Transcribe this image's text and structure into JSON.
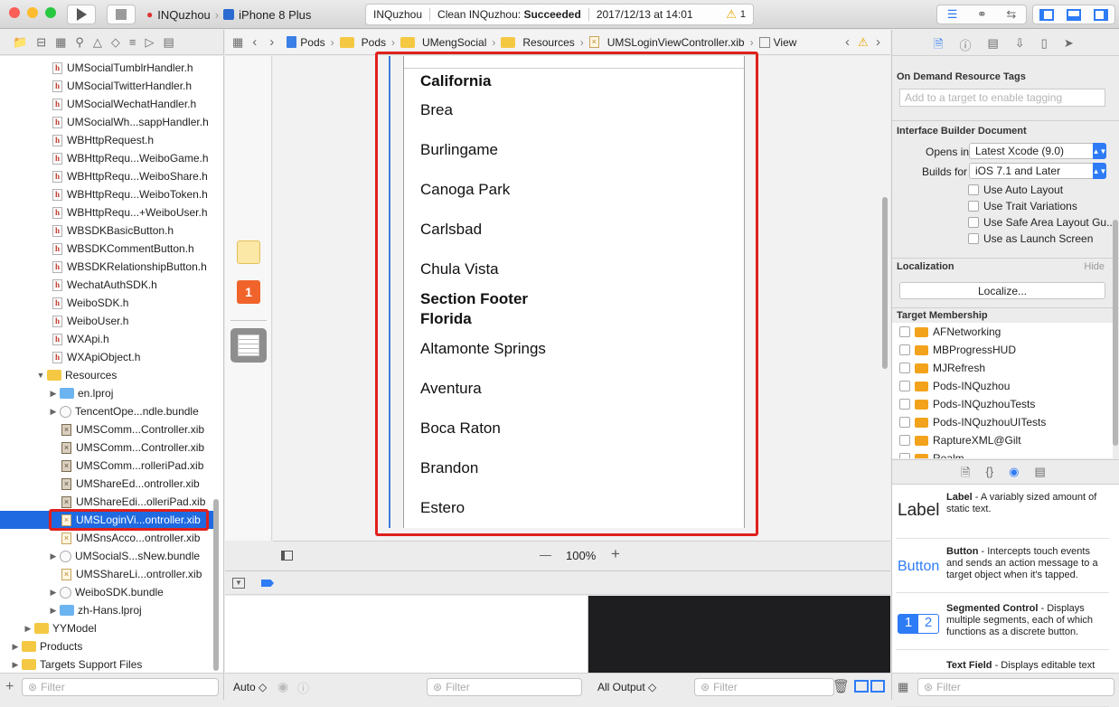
{
  "toolbar": {
    "scheme": "INQuzhou",
    "device": "iPhone 8 Plus",
    "activity": {
      "project": "INQuzhou",
      "action": "Clean INQuzhou:",
      "status": "Succeeded",
      "timestamp": "2017/12/13 at 14:01",
      "warnings": "1"
    }
  },
  "navigator": {
    "rows": [
      {
        "label": "UMSocialTumblrHandler.h",
        "kind": "h",
        "indent": 1
      },
      {
        "label": "UMSocialTwitterHandler.h",
        "kind": "h",
        "indent": 1
      },
      {
        "label": "UMSocialWechatHandler.h",
        "kind": "h",
        "indent": 1
      },
      {
        "label": "UMSocialWh...sappHandler.h",
        "kind": "h",
        "indent": 1
      },
      {
        "label": "WBHttpRequest.h",
        "kind": "h",
        "indent": 1
      },
      {
        "label": "WBHttpRequ...WeiboGame.h",
        "kind": "h",
        "indent": 1
      },
      {
        "label": "WBHttpRequ...WeiboShare.h",
        "kind": "h",
        "indent": 1
      },
      {
        "label": "WBHttpRequ...WeiboToken.h",
        "kind": "h",
        "indent": 1
      },
      {
        "label": "WBHttpRequ...+WeiboUser.h",
        "kind": "h",
        "indent": 1
      },
      {
        "label": "WBSDKBasicButton.h",
        "kind": "h",
        "indent": 1
      },
      {
        "label": "WBSDKCommentButton.h",
        "kind": "h",
        "indent": 1
      },
      {
        "label": "WBSDKRelationshipButton.h",
        "kind": "h",
        "indent": 1
      },
      {
        "label": "WechatAuthSDK.h",
        "kind": "h",
        "indent": 1
      },
      {
        "label": "WeiboSDK.h",
        "kind": "h",
        "indent": 1
      },
      {
        "label": "WeiboUser.h",
        "kind": "h",
        "indent": 1
      },
      {
        "label": "WXApi.h",
        "kind": "h",
        "indent": 1
      },
      {
        "label": "WXApiObject.h",
        "kind": "h",
        "indent": 1
      },
      {
        "label": "Resources",
        "kind": "folder-open",
        "indent": 0
      },
      {
        "label": "en.lproj",
        "kind": "folder-blue",
        "indent": 1
      },
      {
        "label": "TencentOpe...ndle.bundle",
        "kind": "bundle",
        "indent": 1
      },
      {
        "label": "UMSComm...Controller.xib",
        "kind": "nib",
        "indent": 2
      },
      {
        "label": "UMSComm...Controller.xib",
        "kind": "nib",
        "indent": 2
      },
      {
        "label": "UMSComm...rolleriPad.xib",
        "kind": "nib",
        "indent": 2
      },
      {
        "label": "UMShareEd...ontroller.xib",
        "kind": "nib",
        "indent": 2
      },
      {
        "label": "UMShareEdi...olleriPad.xib",
        "kind": "nib",
        "indent": 2
      },
      {
        "label": "UMSLoginVi...ontroller.xib",
        "kind": "xib",
        "indent": 2,
        "selected": true
      },
      {
        "label": "UMSnsAcco...ontroller.xib",
        "kind": "xib",
        "indent": 2
      },
      {
        "label": "UMSocialS...sNew.bundle",
        "kind": "bundle",
        "indent": 1
      },
      {
        "label": "UMSShareLi...ontroller.xib",
        "kind": "xib",
        "indent": 2
      },
      {
        "label": "WeiboSDK.bundle",
        "kind": "bundle",
        "indent": 1
      },
      {
        "label": "zh-Hans.lproj",
        "kind": "folder-blue",
        "indent": 1
      },
      {
        "label": "YYModel",
        "kind": "folder",
        "indent": -1
      },
      {
        "label": "Products",
        "kind": "folder",
        "indent": -2
      },
      {
        "label": "Targets Support Files",
        "kind": "folder",
        "indent": -2
      }
    ],
    "filter_placeholder": "Filter"
  },
  "jumpbar": {
    "crumbs": [
      "Pods",
      "Pods",
      "UMengSocial",
      "Resources",
      "UMSLoginViewController.xib",
      "View"
    ]
  },
  "tableview": {
    "cells": [
      {
        "text": "California",
        "header": true
      },
      {
        "text": "Brea"
      },
      {
        "text": "Burlingame"
      },
      {
        "text": "Canoga Park"
      },
      {
        "text": "Carlsbad"
      },
      {
        "text": "Chula Vista"
      },
      {
        "text": "Section Footer",
        "header": true
      },
      {
        "text": "Florida",
        "header": true
      },
      {
        "text": "Altamonte Springs"
      },
      {
        "text": "Aventura"
      },
      {
        "text": "Boca Raton"
      },
      {
        "text": "Brandon"
      },
      {
        "text": "Estero"
      }
    ]
  },
  "canvas": {
    "zoom": "100%",
    "zoom_out": "—",
    "zoom_in": "+"
  },
  "debug": {
    "auto_label": "Auto ◇",
    "output_label": "All Output ◇",
    "filter_placeholder": "Filter"
  },
  "inspector": {
    "odr_title": "On Demand Resource Tags",
    "odr_placeholder": "Add to a target to enable tagging",
    "ibdoc_title": "Interface Builder Document",
    "opens_in_label": "Opens in",
    "opens_in_value": "Latest Xcode (9.0)",
    "builds_for_label": "Builds for",
    "builds_for_value": "iOS 7.1 and Later",
    "options": [
      "Use Auto Layout",
      "Use Trait Variations",
      "Use Safe Area Layout Gu...",
      "Use as Launch Screen"
    ],
    "localization_title": "Localization",
    "localization_hide": "Hide",
    "localize_button": "Localize...",
    "membership_title": "Target Membership",
    "targets": [
      "AFNetworking",
      "MBProgressHUD",
      "MJRefresh",
      "Pods-INQuzhou",
      "Pods-INQuzhouTests",
      "Pods-INQuzhouUITests",
      "RaptureXML@Gilt",
      "Realm"
    ],
    "library": [
      {
        "big": "Label",
        "title": "Label",
        "desc": " - A variably sized amount of static text."
      },
      {
        "big": "Button",
        "title": "Button",
        "desc": " - Intercepts touch events and sends an action message to a target object when it's tapped."
      },
      {
        "big": "12",
        "title": "Segmented Control",
        "desc": " - Displays multiple segments, each of which functions as a discrete button."
      },
      {
        "big": "",
        "title": "Text Field",
        "desc": " - Displays editable text"
      }
    ],
    "filter_placeholder": "Filter"
  },
  "colors": {
    "selection": "#1f6ae0",
    "highlight": "#e0201c",
    "accent": "#2e7bf6"
  }
}
